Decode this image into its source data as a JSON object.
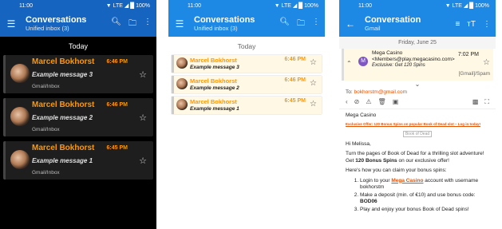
{
  "status": {
    "time": "11:00",
    "signal": "▼ LTE ◢ █ 100%"
  },
  "panels": [
    {
      "title": "Conversations",
      "subtitle": "Unified inbox (3)",
      "day": "Today",
      "items": [
        {
          "sender": "Marcel Bokhorst",
          "time": "6:46 PM",
          "subject": "Example message 3",
          "folder": "Gmail/Inbox"
        },
        {
          "sender": "Marcel Bokhorst",
          "time": "6:46 PM",
          "subject": "Example message 2",
          "folder": "Gmail/Inbox"
        },
        {
          "sender": "Marcel Bokhorst",
          "time": "6:45 PM",
          "subject": "Example message 1",
          "folder": "Gmail/Inbox"
        }
      ]
    },
    {
      "title": "Conversations",
      "subtitle": "Unified inbox (3)",
      "day": "Today",
      "items": [
        {
          "sender": "Marcel Bokhorst",
          "time": "6:46 PM",
          "subject": "Example message 3"
        },
        {
          "sender": "Marcel Bokhorst",
          "time": "6:46 PM",
          "subject": "Example message 2"
        },
        {
          "sender": "Marcel Bokhorst",
          "time": "6:45 PM",
          "subject": "Example message 1"
        }
      ]
    }
  ],
  "conversation": {
    "title": "Conversation",
    "subtitle": "Gmail",
    "day": "Friday, June 25",
    "avatar_letter": "M",
    "from": "Mega Casino <Members@play.megacasino.com>",
    "excerpt": "Exclusive: Get 120 Spins",
    "time": "7:02 PM",
    "label": "[Gmail]/Spam",
    "to_label": "To:",
    "to": "bokhorstm@gmail.com",
    "body": {
      "sender_line": "Mega Casino",
      "offer_line": "Exclusive Offer: 120 Bonus Spins on popular Book of Dead slot – Log in today!",
      "image_alt": "Book of Dead",
      "greeting": "Hi Melissa,",
      "p1_a": "Turn the pages of Book of Dead for a thrilling slot adventure! Get ",
      "p1_bold": "120 Bonus Spins",
      "p1_b": " on our exclusive offer!",
      "p2": "Here's how you can claim your bonus spins:",
      "step1_a": "Login to your ",
      "step1_link": "Mega Casino",
      "step1_b": " account with username bokhorstm",
      "step2_a": "Make a deposit (min. of €10) and use bonus code: ",
      "step2_code": "BOD06",
      "step3": "Play and enjoy your bonus Book of Dead spins!"
    }
  },
  "icons": [
    "menu-icon",
    "search-icon",
    "folder-icon",
    "more-icon",
    "star-icon",
    "back-icon",
    "sort-icon",
    "text-size-icon",
    "chevron-up-icon",
    "chevron-down-icon",
    "reply-icon",
    "block-icon",
    "warning-icon",
    "delete-icon",
    "move-icon",
    "image-icon",
    "fullscreen-icon"
  ]
}
